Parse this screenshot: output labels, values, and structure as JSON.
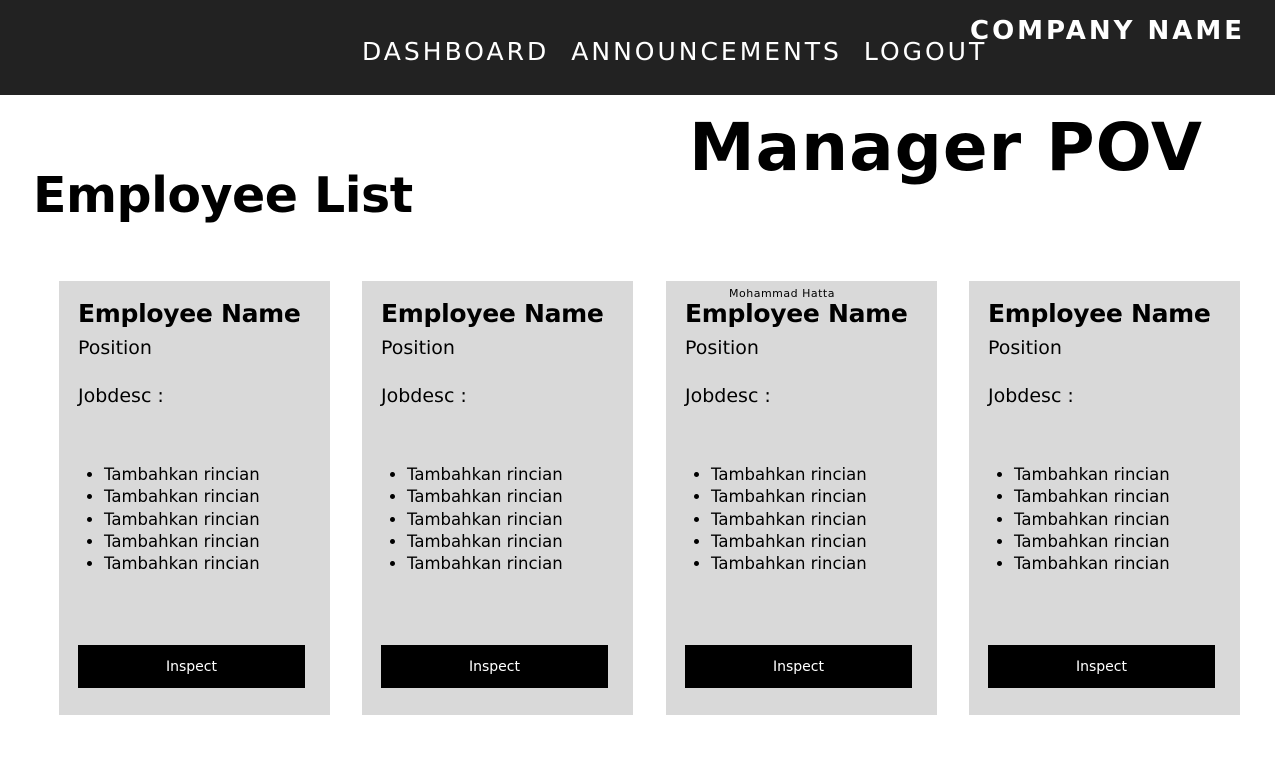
{
  "header": {
    "nav": [
      "DASHBOARD",
      "ANNOUNCEMENTS",
      "LOGOUT"
    ],
    "company": "COMPANY NAME"
  },
  "pov_title": "Manager POV",
  "list_title": "Employee List",
  "cards": [
    {
      "name": "Employee Name",
      "position": "Position",
      "jobdesc_label": "Jobdesc :",
      "details": [
        "Tambahkan rincian",
        "Tambahkan rincian",
        "Tambahkan rincian",
        "Tambahkan rincian",
        "Tambahkan rincian"
      ],
      "button": "Inspect"
    },
    {
      "name": "Employee Name",
      "position": "Position",
      "jobdesc_label": "Jobdesc :",
      "details": [
        "Tambahkan rincian",
        "Tambahkan rincian",
        "Tambahkan rincian",
        "Tambahkan rincian",
        "Tambahkan rincian"
      ],
      "button": "Inspect"
    },
    {
      "note": "Mohammad Hatta",
      "name": "Employee Name",
      "position": "Position",
      "jobdesc_label": "Jobdesc :",
      "details": [
        "Tambahkan rincian",
        "Tambahkan rincian",
        "Tambahkan rincian",
        "Tambahkan rincian",
        "Tambahkan rincian"
      ],
      "button": "Inspect"
    },
    {
      "name": "Employee Name",
      "position": "Position",
      "jobdesc_label": "Jobdesc :",
      "details": [
        "Tambahkan rincian",
        "Tambahkan rincian",
        "Tambahkan rincian",
        "Tambahkan rincian",
        "Tambahkan rincian"
      ],
      "button": "Inspect"
    }
  ]
}
